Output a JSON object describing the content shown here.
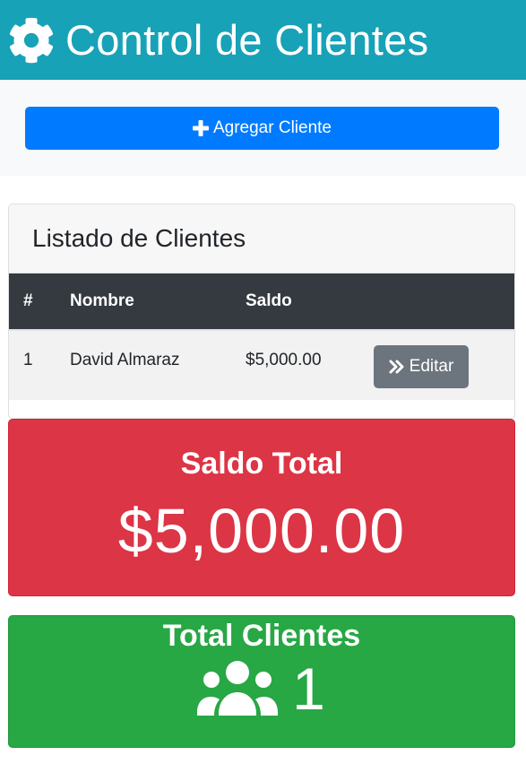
{
  "header": {
    "title": "Control de Clientes",
    "icon": "gear-icon"
  },
  "actions": {
    "add_label": "Agregar Cliente",
    "add_icon": "plus-icon"
  },
  "clients_card": {
    "title": "Listado de Clientes",
    "columns": [
      "#",
      "Nombre",
      "Saldo",
      ""
    ],
    "rows": [
      {
        "index": "1",
        "name": "David Almaraz",
        "balance": "$5,000.00",
        "action_label": "Editar"
      }
    ]
  },
  "total_balance": {
    "title": "Saldo Total",
    "value": "$5,000.00"
  },
  "total_clients": {
    "title": "Total Clientes",
    "value": "1",
    "icon": "users-icon"
  },
  "colors": {
    "header": "#17a2b8",
    "primary": "#007bff",
    "secondary": "#6c757d",
    "danger": "#dc3545",
    "success": "#28a745",
    "dark": "#343a40"
  }
}
